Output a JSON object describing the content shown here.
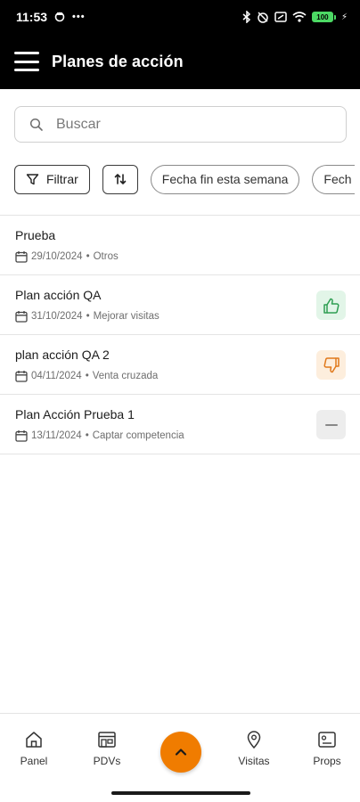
{
  "status_bar": {
    "time": "11:53",
    "battery": "100"
  },
  "app_bar": {
    "title": "Planes de acción"
  },
  "search": {
    "placeholder": "Buscar",
    "value": ""
  },
  "filters": {
    "filter_label": "Filtrar",
    "chips": [
      "Fecha fin esta semana",
      "Fech"
    ]
  },
  "plans": [
    {
      "title": "Prueba",
      "date": "29/10/2024",
      "category": "Otros",
      "status": null
    },
    {
      "title": "Plan acción QA",
      "date": "31/10/2024",
      "category": "Mejorar visitas",
      "status": "thumbs-up"
    },
    {
      "title": "plan acción QA 2",
      "date": "04/11/2024",
      "category": "Venta cruzada",
      "status": "thumbs-down"
    },
    {
      "title": "Plan Acción Prueba 1",
      "date": "13/11/2024",
      "category": "Captar competencia",
      "status": "neutral"
    }
  ],
  "bottom_nav": {
    "items": [
      {
        "label": "Panel",
        "icon": "home-icon"
      },
      {
        "label": "PDVs",
        "icon": "store-icon"
      },
      {
        "label": "Visitas",
        "icon": "location-pin-icon"
      },
      {
        "label": "Props",
        "icon": "id-card-icon"
      }
    ],
    "fab_icon": "chevron-up-icon"
  },
  "colors": {
    "accent": "#f07c00",
    "header_bg": "#000000",
    "positive": "#2e9e52",
    "negative": "#e0781a",
    "neutral": "#888888"
  }
}
